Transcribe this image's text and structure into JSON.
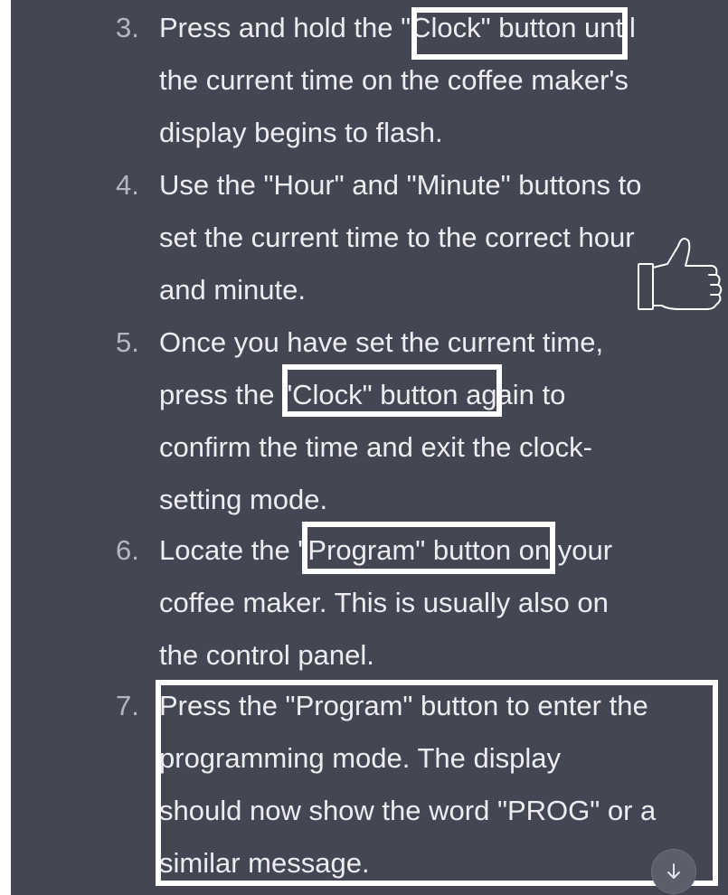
{
  "steps": [
    {
      "number": "3.",
      "lines": [
        "Press and hold the \"Clock\" button until",
        "the current time on the coffee maker's",
        "display begins to flash."
      ]
    },
    {
      "number": "4.",
      "lines": [
        "Use the \"Hour\" and \"Minute\" buttons to",
        "set the current time to the correct hour",
        "and minute."
      ]
    },
    {
      "number": "5.",
      "lines": [
        "Once you have set the current time,",
        "press the \"Clock\" button again to",
        "confirm the time and exit the clock-",
        "setting mode."
      ]
    },
    {
      "number": "6.",
      "lines": [
        "Locate the \"Program\" button on your",
        "coffee maker. This is usually also on",
        "the control panel."
      ]
    },
    {
      "number": "7.",
      "lines": [
        "Press the \"Program\" button to enter the",
        "programming mode. The display",
        "should now show the word \"PROG\" or a",
        "similar message."
      ]
    }
  ],
  "icons": {
    "thumbs_up": "thumbs-up-icon",
    "scroll_down": "arrow-down-icon"
  },
  "colors": {
    "background": "#444654",
    "text": "#ececf1",
    "number": "#b5b6c0",
    "highlight": "#ffffff"
  }
}
